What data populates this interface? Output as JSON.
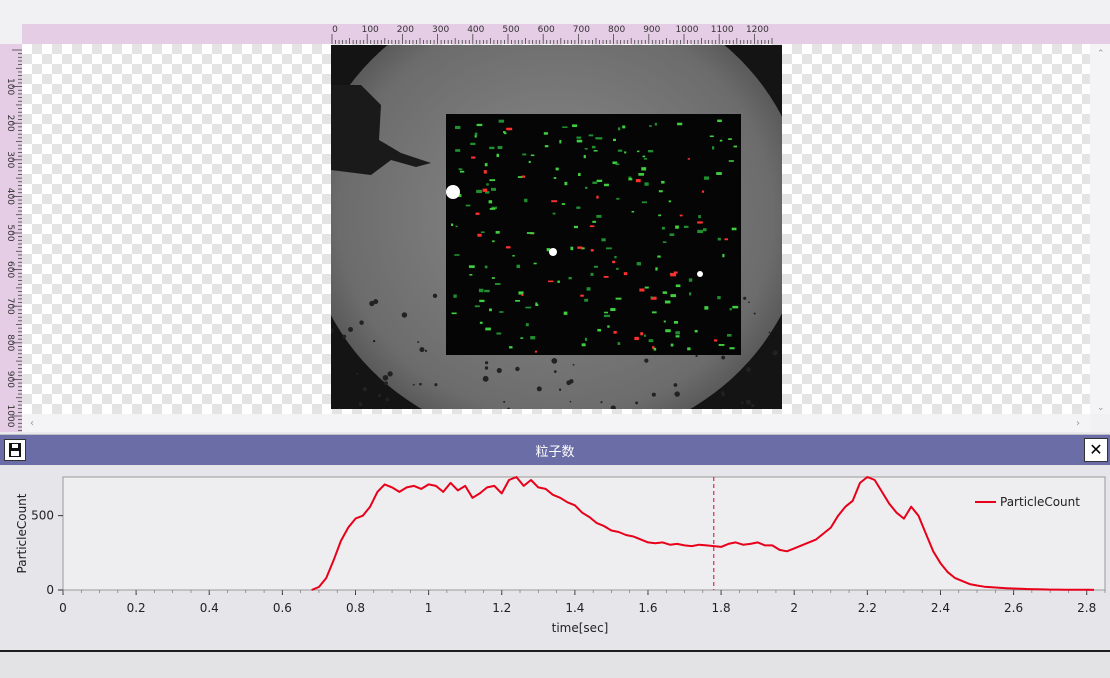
{
  "viewer": {
    "ruler_top_ticks": [
      "0",
      "100",
      "200",
      "300",
      "400",
      "500",
      "600",
      "700",
      "800",
      "900",
      "1000",
      "1100",
      "1200"
    ],
    "ruler_left_ticks": [
      "100",
      "200",
      "300",
      "400",
      "500",
      "600",
      "700",
      "800",
      "900",
      "1000"
    ],
    "colors": {
      "ruler_bg": "#e6cde6",
      "checker": "#e4e4e4"
    }
  },
  "panel": {
    "title": "粒子数",
    "close_label": "✕",
    "header_color": "#6a6da6"
  },
  "chart_data": {
    "type": "line",
    "xlabel": "time[sec]",
    "ylabel": "ParticleCount",
    "xlim": [
      0,
      2.85
    ],
    "ylim": [
      0,
      760
    ],
    "x_ticks": [
      "0",
      "0.2",
      "0.4",
      "0.6",
      "0.8",
      "1",
      "1.2",
      "1.4",
      "1.6",
      "1.8",
      "2",
      "2.2",
      "2.4",
      "2.6",
      "2.8"
    ],
    "y_ticks": [
      "0",
      "500"
    ],
    "cursor_x": 1.78,
    "legend_position": "top-right",
    "series": [
      {
        "name": "ParticleCount",
        "color": "#e8001a",
        "x": [
          0.68,
          0.7,
          0.72,
          0.74,
          0.76,
          0.78,
          0.8,
          0.82,
          0.84,
          0.86,
          0.88,
          0.9,
          0.92,
          0.94,
          0.96,
          0.98,
          1.0,
          1.02,
          1.04,
          1.06,
          1.08,
          1.1,
          1.12,
          1.14,
          1.16,
          1.18,
          1.2,
          1.22,
          1.24,
          1.26,
          1.28,
          1.3,
          1.32,
          1.34,
          1.36,
          1.38,
          1.4,
          1.42,
          1.44,
          1.46,
          1.48,
          1.5,
          1.52,
          1.54,
          1.56,
          1.58,
          1.6,
          1.62,
          1.64,
          1.66,
          1.68,
          1.7,
          1.72,
          1.74,
          1.76,
          1.78,
          1.8,
          1.82,
          1.84,
          1.86,
          1.88,
          1.9,
          1.92,
          1.94,
          1.96,
          1.98,
          2.0,
          2.02,
          2.04,
          2.06,
          2.08,
          2.1,
          2.12,
          2.14,
          2.16,
          2.18,
          2.2,
          2.22,
          2.24,
          2.26,
          2.28,
          2.3,
          2.32,
          2.34,
          2.36,
          2.38,
          2.4,
          2.42,
          2.44,
          2.46,
          2.48,
          2.5,
          2.52,
          2.54,
          2.56,
          2.58,
          2.6,
          2.62,
          2.64,
          2.66,
          2.68,
          2.7,
          2.72,
          2.74,
          2.76,
          2.78,
          2.8,
          2.82
        ],
        "values": [
          0,
          20,
          80,
          200,
          330,
          420,
          480,
          500,
          560,
          660,
          710,
          690,
          660,
          690,
          700,
          680,
          710,
          700,
          660,
          720,
          670,
          700,
          620,
          650,
          690,
          700,
          650,
          740,
          760,
          700,
          740,
          690,
          680,
          640,
          620,
          590,
          570,
          520,
          490,
          450,
          430,
          400,
          390,
          370,
          360,
          340,
          320,
          315,
          320,
          305,
          310,
          300,
          295,
          305,
          300,
          295,
          290,
          310,
          320,
          305,
          310,
          320,
          300,
          300,
          270,
          260,
          280,
          300,
          320,
          340,
          380,
          420,
          500,
          560,
          600,
          720,
          760,
          740,
          660,
          580,
          520,
          480,
          560,
          500,
          380,
          260,
          180,
          120,
          80,
          60,
          40,
          30,
          22,
          18,
          15,
          12,
          10,
          8,
          6,
          5,
          4,
          3,
          3,
          2,
          2,
          2,
          2,
          1
        ]
      }
    ]
  }
}
